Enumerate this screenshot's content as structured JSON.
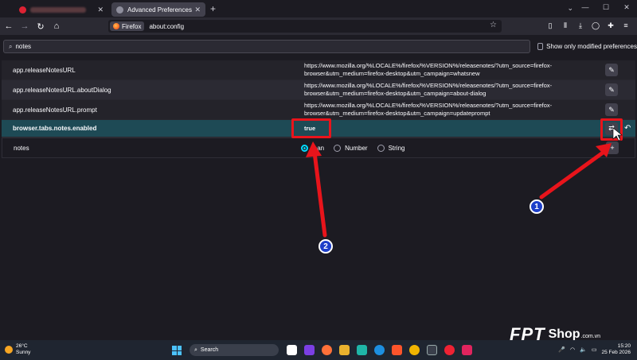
{
  "browser": {
    "tabs": [
      {
        "label": "",
        "active": false
      },
      {
        "label": "Advanced Preferences",
        "active": true
      }
    ],
    "identity_label": "Firefox",
    "url": "about:config"
  },
  "config": {
    "search_value": "notes",
    "show_modified_label": "Show only modified preferences",
    "rows": [
      {
        "name": "app.releaseNotesURL",
        "value": "https://www.mozilla.org/%LOCALE%/firefox/%VERSION%/releasenotes/?utm_source=firefox-browser&utm_medium=firefox-desktop&utm_campaign=whatsnew",
        "modified": false
      },
      {
        "name": "app.releaseNotesURL.aboutDialog",
        "value": "https://www.mozilla.org/%LOCALE%/firefox/%VERSION%/releasenotes/?utm_source=firefox-browser&utm_medium=firefox-desktop&utm_campaign=about-dialog",
        "modified": false
      },
      {
        "name": "app.releaseNotesURL.prompt",
        "value": "https://www.mozilla.org/%LOCALE%/firefox/%VERSION%/releasenotes/?utm_source=firefox-browser&utm_medium=firefox-desktop&utm_campaign=updateprompt",
        "modified": false
      },
      {
        "name": "browser.tabs.notes.enabled",
        "value": "true",
        "modified": true
      }
    ],
    "new_pref": {
      "name": "notes",
      "types": [
        "Boolean",
        "Number",
        "String"
      ],
      "types_shown": [
        "lean",
        "Number",
        "String"
      ],
      "selected": "Boolean"
    }
  },
  "annotations": {
    "badge_1": "1",
    "badge_2": "2",
    "color": "#e8141b"
  },
  "taskbar": {
    "temp": "26°C",
    "weather": "Sunny",
    "search_label": "Search",
    "time": "15:20",
    "date": "25 Feb 2026"
  },
  "watermark": {
    "brand": "FPT",
    "shop": "Shop",
    "domain": ".com.vn"
  }
}
